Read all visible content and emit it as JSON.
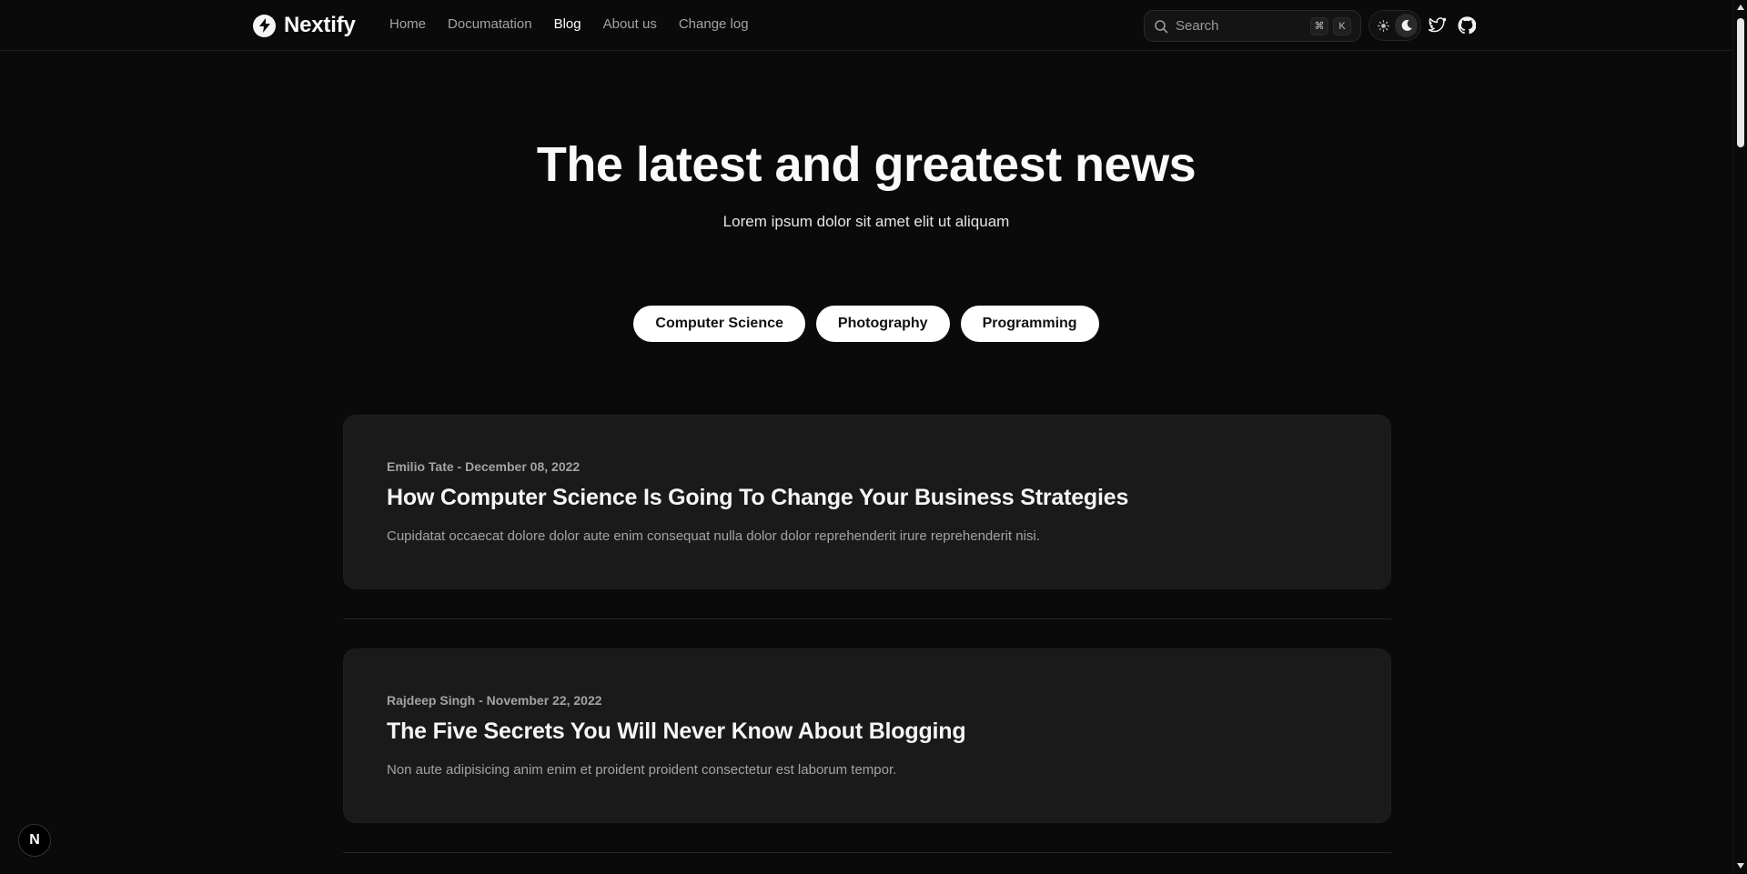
{
  "brand": {
    "name": "Nextify",
    "logo_icon": "lightning-icon"
  },
  "nav": {
    "items": [
      {
        "label": "Home"
      },
      {
        "label": "Documatation"
      },
      {
        "label": "Blog",
        "active": true
      },
      {
        "label": "About us"
      },
      {
        "label": "Change log"
      }
    ]
  },
  "search": {
    "placeholder": "Search",
    "shortcut_mod": "⌘",
    "shortcut_key": "K"
  },
  "theme": {
    "light_icon": "sun-icon",
    "dark_icon": "moon-icon",
    "selected": "dark"
  },
  "social": {
    "twitter_icon": "twitter-icon",
    "github_icon": "github-icon"
  },
  "hero": {
    "title": "The latest and greatest news",
    "subtitle": "Lorem ipsum dolor sit amet elit ut aliquam"
  },
  "categories": [
    "Computer Science",
    "Photography",
    "Programming"
  ],
  "posts": [
    {
      "meta": "Emilio Tate - December 08, 2022",
      "title": "How Computer Science Is Going To Change Your Business Strategies",
      "excerpt": "Cupidatat occaecat dolore dolor aute enim consequat nulla dolor dolor reprehenderit irure reprehenderit nisi."
    },
    {
      "meta": "Rajdeep Singh - November 22, 2022",
      "title": "The Five Secrets You Will Never Know About Blogging",
      "excerpt": "Non aute adipisicing anim enim et proident proident consectetur est laborum tempor."
    }
  ],
  "badge": {
    "label": "N"
  },
  "colors": {
    "background": "#0a0a0a",
    "card": "#1a1a1a",
    "chip": "#ffffff",
    "text": "#ededed",
    "muted": "#a3a3a3"
  }
}
